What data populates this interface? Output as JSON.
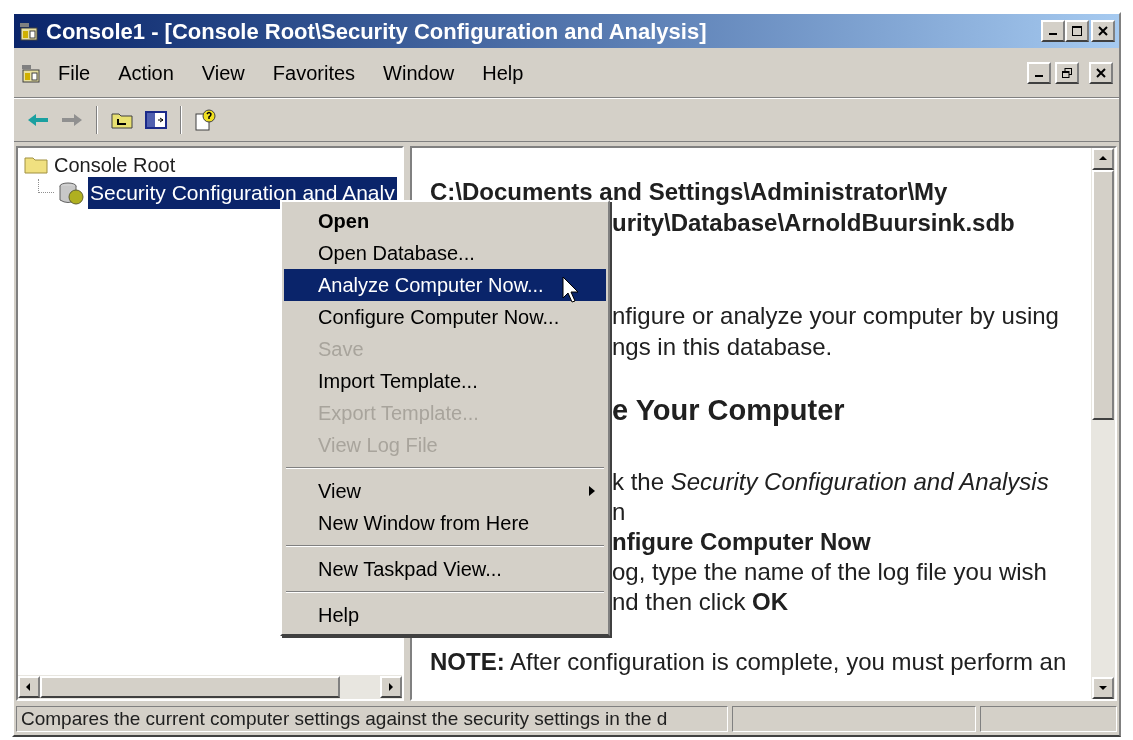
{
  "window": {
    "title": "Console1 - [Console Root\\Security Configuration and Analysis]"
  },
  "menu_bar": [
    {
      "label": "File"
    },
    {
      "label": "Action"
    },
    {
      "label": "View"
    },
    {
      "label": "Favorites"
    },
    {
      "label": "Window"
    },
    {
      "label": "Help"
    }
  ],
  "tree": {
    "label": "Console Root",
    "children": [
      {
        "label": "Security Configuration and Analy",
        "selected": true
      }
    ]
  },
  "content": [
    {
      "kind": "path",
      "lines": [
        {
          "text": "C:\\Documents and Settings\\Administrator\\My",
          "covered": false
        },
        {
          "text": "urity\\Database\\ArnoldBuursink.sdb",
          "covered": true
        }
      ]
    },
    {
      "kind": "body",
      "lines": [
        {
          "text": "nfigure or analyze your computer by using",
          "covered": true
        },
        {
          "text": "ngs in this database.",
          "covered": true
        }
      ]
    },
    {
      "kind": "heading",
      "lines": [
        {
          "text": "e Your Computer",
          "covered": true
        }
      ]
    },
    {
      "kind": "steps",
      "lines": [
        {
          "text": "k the *Security Configuration and Analysis*",
          "covered": true
        },
        {
          "text": "n",
          "covered": true
        },
        {
          "text": "**nfigure Computer Now**",
          "covered": true
        },
        {
          "text": "og, type the name of the log file you wish",
          "covered": true
        },
        {
          "text": "nd then click **OK**",
          "covered": true
        }
      ]
    },
    {
      "kind": "note",
      "lines": [
        {
          "text": "**NOTE:** After configuration is complete, you must perform an",
          "covered": false
        }
      ]
    }
  ],
  "context_menu": [
    {
      "kind": "item",
      "label": "Open",
      "default": true,
      "selected": false,
      "disabled": false
    },
    {
      "kind": "item",
      "label": "Open Database...",
      "default": false,
      "selected": false,
      "disabled": false
    },
    {
      "kind": "item",
      "label": "Analyze Computer Now...",
      "default": false,
      "selected": true,
      "disabled": false
    },
    {
      "kind": "item",
      "label": "Configure Computer Now...",
      "default": false,
      "selected": false,
      "disabled": false
    },
    {
      "kind": "item",
      "label": "Save",
      "default": false,
      "selected": false,
      "disabled": true
    },
    {
      "kind": "item",
      "label": "Import Template...",
      "default": false,
      "selected": false,
      "disabled": false
    },
    {
      "kind": "item",
      "label": "Export Template...",
      "default": false,
      "selected": false,
      "disabled": true
    },
    {
      "kind": "item",
      "label": "View Log File",
      "default": false,
      "selected": false,
      "disabled": true
    },
    {
      "kind": "separator"
    },
    {
      "kind": "submenu",
      "label": "View",
      "default": false,
      "selected": false,
      "disabled": false
    },
    {
      "kind": "item",
      "label": "New Window from Here",
      "default": false,
      "selected": false,
      "disabled": false
    },
    {
      "kind": "separator"
    },
    {
      "kind": "item",
      "label": "New Taskpad View...",
      "default": false,
      "selected": false,
      "disabled": false
    },
    {
      "kind": "separator"
    },
    {
      "kind": "item",
      "label": "Help",
      "default": false,
      "selected": false,
      "disabled": false
    }
  ],
  "status_bar": [
    "Compares the current computer settings against the security settings in the d"
  ]
}
